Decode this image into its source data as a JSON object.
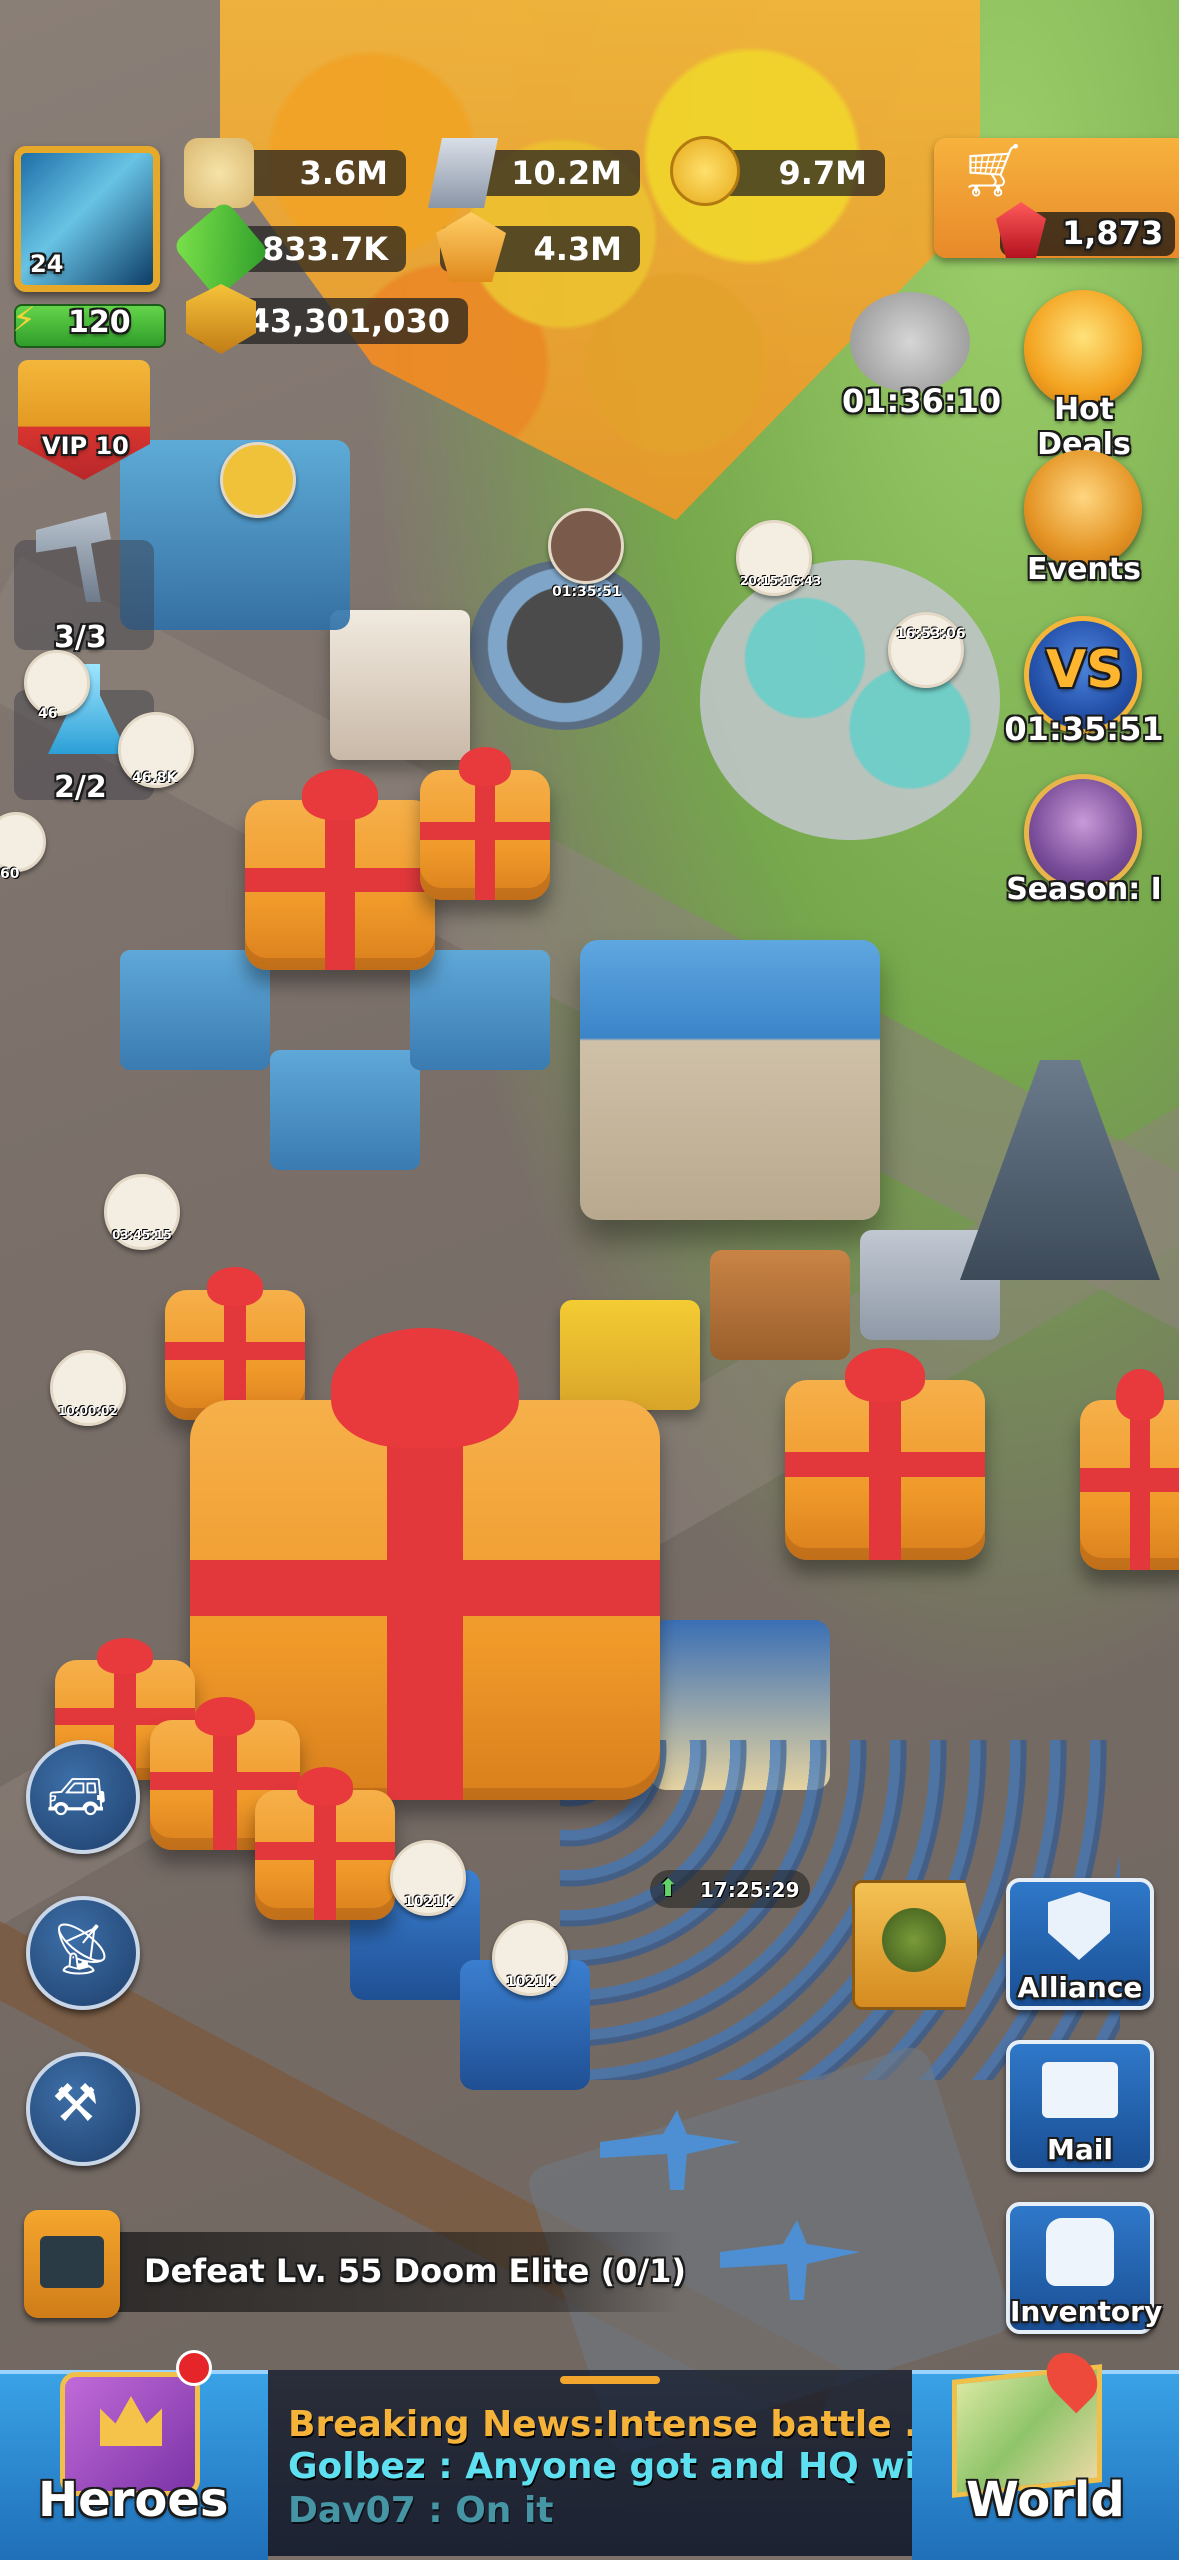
{
  "player": {
    "level": "24",
    "energy": "120",
    "vip": "VIP 10",
    "power": "43,301,030"
  },
  "resources": {
    "food": "3.6M",
    "iron": "10.2M",
    "gold": "9.7M",
    "oil": "833.7K",
    "crystal": "4.3M"
  },
  "shop": {
    "gems": "1,873"
  },
  "right_menu": {
    "top_timer": "01:36:10",
    "hot_deals": "Hot Deals",
    "events": "Events",
    "vs_timer": "01:35:51",
    "season": "Season: I"
  },
  "left_menu": {
    "builders": "3/3",
    "research": "2/2",
    "marker_a": "46.8K",
    "marker_b": "46",
    "marker_c": "60"
  },
  "map_timers": {
    "t1": "01:35:51",
    "t2": "20:15:16:43",
    "t3": "16:53:06",
    "t4": "03:45:15",
    "t5": "10:00:02",
    "t6": "17:25:29",
    "exp1": "1021K",
    "exp2": "1021K"
  },
  "right_panel": {
    "alliance": "Alliance",
    "mail": "Mail",
    "inventory": "Inventory"
  },
  "quest": {
    "text": "Defeat Lv. 55 Doom Elite (0/1)"
  },
  "bottom": {
    "heroes": "Heroes",
    "world": "World",
    "news": [
      "Breaking News:Intense battle ...",
      "Golbez : Anyone got and HQ with ...",
      "Dav07 : On it"
    ]
  }
}
